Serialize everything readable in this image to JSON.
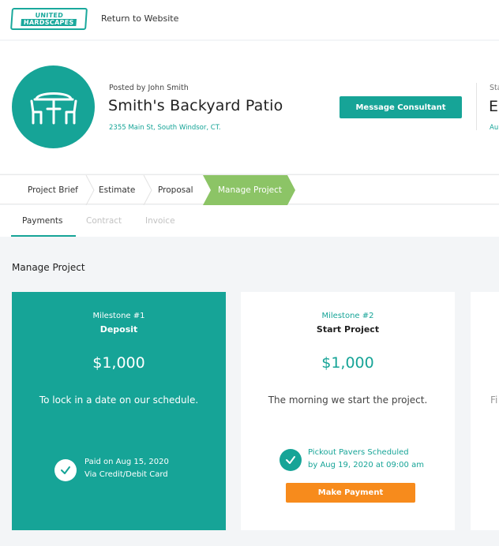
{
  "brand": {
    "line1": "UNITED",
    "line2": "HARDSCAPES",
    "accent": "#16a497"
  },
  "nav": {
    "return_label": "Return to Website"
  },
  "project": {
    "posted_by": "Posted by John Smith",
    "title": "Smith's Backyard Patio",
    "address": "2355 Main St, South Windsor, CT.",
    "message_label": "Message Consultant",
    "avatar_icon": "patio-table-icon",
    "side_label_trunc": "Sta",
    "side_title_trunc": "Es",
    "side_value_trunc": "Au"
  },
  "steps": [
    {
      "label": "Project Brief",
      "active": false
    },
    {
      "label": "Estimate",
      "active": false
    },
    {
      "label": "Proposal",
      "active": false
    },
    {
      "label": "Manage Project",
      "active": true
    }
  ],
  "step_active_color": "#8cc466",
  "subtabs": [
    {
      "label": "Payments",
      "active": true
    },
    {
      "label": "Contract",
      "active": false
    },
    {
      "label": "Invoice",
      "active": false
    }
  ],
  "section_title": "Manage Project",
  "milestones": [
    {
      "number": "Milestone #1",
      "name": "Deposit",
      "amount": "$1,000",
      "description": "To lock in a date on our schedule.",
      "status_line1": "Paid on Aug 15, 2020",
      "status_line2": "Via Credit/Debit Card"
    },
    {
      "number": "Milestone #2",
      "name": "Start Project",
      "amount": "$1,000",
      "description": "The morning we start the project.",
      "status_line1": "Pickout Pavers Scheduled",
      "status_line2": "by Aug 19, 2020 at 09:00 am",
      "action_label": "Make Payment",
      "action_color": "#f78b1c"
    },
    {
      "description_trunc": "Fi"
    }
  ]
}
